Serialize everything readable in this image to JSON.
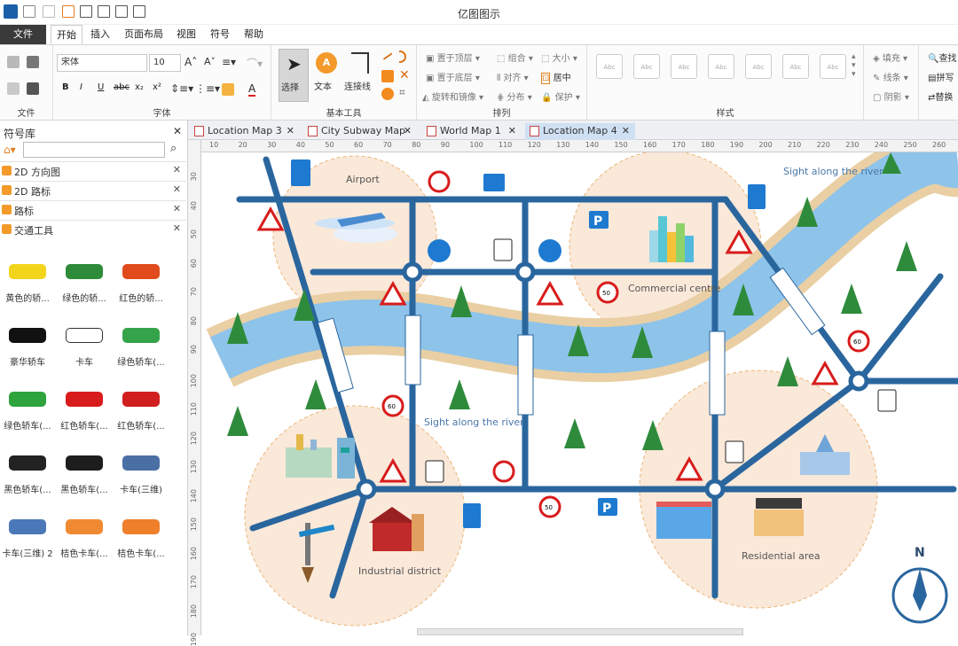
{
  "app": {
    "title": "亿图图示"
  },
  "menu": {
    "file": "文件",
    "tabs": [
      "开始",
      "插入",
      "页面布局",
      "视图",
      "符号",
      "帮助"
    ]
  },
  "ribbon": {
    "file_group": "文件",
    "font_group": "字体",
    "font_name": "宋体",
    "font_size": "10",
    "basic_tools_group": "基本工具",
    "select": "选择",
    "text": "文本",
    "connector": "连接线",
    "arrange_group": "排列",
    "bring_front": "置于顶层",
    "send_back": "置于底层",
    "rotate_mirror": "旋转和镜像",
    "group": "组合",
    "align": "对齐",
    "distribute": "分布",
    "size": "大小",
    "center": "居中",
    "protect": "保护",
    "styles_group": "样式",
    "style_sample": "Abc",
    "fill": "填充",
    "line": "线条",
    "shadow": "阴影",
    "find": "查找",
    "spell": "拼写",
    "replace": "替换"
  },
  "library": {
    "title": "符号库",
    "categories": [
      "2D 方向图",
      "2D 路标",
      "路标",
      "交通工具"
    ],
    "items": [
      {
        "label": "黄色的轿...",
        "color": "#f2d41a"
      },
      {
        "label": "绿色的轿...",
        "color": "#2e8b3a"
      },
      {
        "label": "红色的轿...",
        "color": "#e04a1c"
      },
      {
        "label": "豪华轿车",
        "color": "#111111"
      },
      {
        "label": "卡车",
        "color": "#ffffff"
      },
      {
        "label": "绿色轿车(...",
        "color": "#35a34a"
      },
      {
        "label": "绿色轿车(...",
        "color": "#2fa33c"
      },
      {
        "label": "红色轿车(...",
        "color": "#d81c1c"
      },
      {
        "label": "红色轿车(...",
        "color": "#d11e1e"
      },
      {
        "label": "黑色轿车(...",
        "color": "#222222"
      },
      {
        "label": "黑色轿车(...",
        "color": "#1d1d1d"
      },
      {
        "label": "卡车(三维)",
        "color": "#4a6fa5"
      },
      {
        "label": "卡车(三维) 2",
        "color": "#4b78b8"
      },
      {
        "label": "桔色卡车(...",
        "color": "#f08a32"
      },
      {
        "label": "桔色卡车(...",
        "color": "#ef7f2a"
      }
    ]
  },
  "doc_tabs": [
    "Location Map 3",
    "City Subway Map",
    "World Map 1",
    "Location Map 4"
  ],
  "ruler_h": [
    "10",
    "20",
    "30",
    "40",
    "50",
    "60",
    "70",
    "80",
    "90",
    "100",
    "110",
    "120",
    "130",
    "140",
    "150",
    "160",
    "170",
    "180",
    "190",
    "200",
    "210",
    "220",
    "230",
    "240",
    "250",
    "260",
    "270"
  ],
  "ruler_v": [
    "30",
    "40",
    "50",
    "60",
    "70",
    "80",
    "90",
    "100",
    "110",
    "120",
    "130",
    "140",
    "150",
    "160",
    "170",
    "180",
    "190"
  ],
  "map": {
    "areas": [
      "Airport",
      "Commercial centre",
      "Industrial district",
      "Residential area"
    ],
    "river_labels": [
      "Sight along the river",
      "Sight along the river"
    ],
    "speed_signs": [
      "50",
      "60",
      "60",
      "50"
    ],
    "compass": "N",
    "colors": {
      "road": "#2a669e",
      "river": "#8ec3ea",
      "bank": "#e9cfa3",
      "zone": "#fae8d9"
    }
  }
}
